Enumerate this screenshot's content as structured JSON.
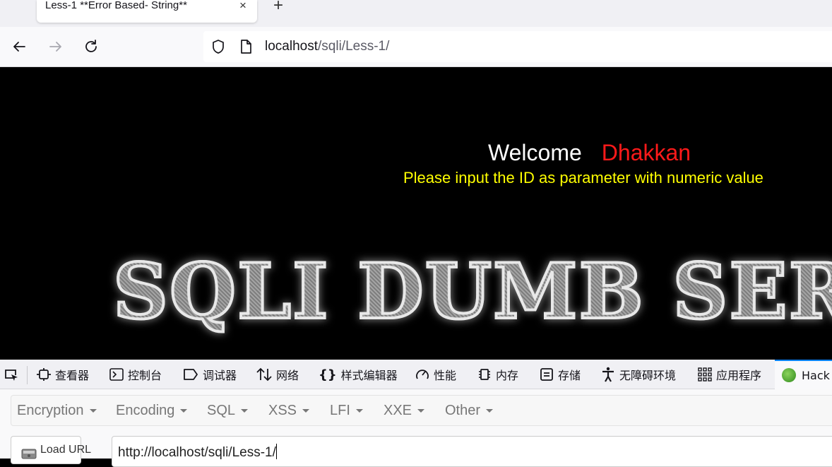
{
  "browser": {
    "tab_title": "Less-1 **Error Based- String**",
    "tab_close": "×",
    "new_tab": "+",
    "url_host": "localhost",
    "url_path": "/sqli/Less-1/"
  },
  "page": {
    "welcome": "Welcome",
    "name": "Dhakkan",
    "instruction": "Please input the ID as parameter with numeric value",
    "banner": "SQLI DUMB SER",
    "colors": {
      "background": "#000000",
      "welcome": "#ffffff",
      "name": "#ff1a1a",
      "instruction": "#ffff00"
    }
  },
  "devtools": {
    "tabs": [
      {
        "label": "查看器",
        "icon": "inspector-icon"
      },
      {
        "label": "控制台",
        "icon": "console-icon"
      },
      {
        "label": "调试器",
        "icon": "debugger-icon"
      },
      {
        "label": "网络",
        "icon": "network-icon"
      },
      {
        "label": "样式编辑器",
        "icon": "style-editor-icon"
      },
      {
        "label": "性能",
        "icon": "performance-icon"
      },
      {
        "label": "内存",
        "icon": "memory-icon"
      },
      {
        "label": "存储",
        "icon": "storage-icon"
      },
      {
        "label": "无障碍环境",
        "icon": "accessibility-icon"
      },
      {
        "label": "应用程序",
        "icon": "application-icon"
      },
      {
        "label": "Hack",
        "icon": "hackbar-icon",
        "active": true
      }
    ]
  },
  "hackbar": {
    "menu": [
      "Encryption",
      "Encoding",
      "SQL",
      "XSS",
      "LFI",
      "XXE",
      "Other"
    ],
    "load_url_label": "Load URL",
    "url_value": "http://localhost/sqli/Less-1/"
  }
}
